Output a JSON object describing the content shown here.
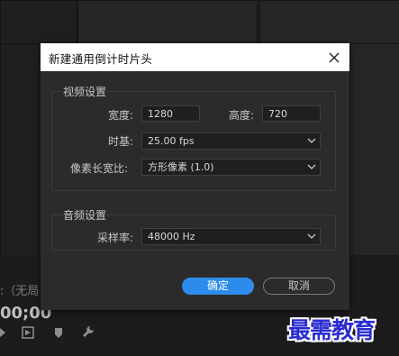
{
  "background": {
    "source_label": ":（无局",
    "timecode": "00;00",
    "icons": [
      "marker-icon",
      "insert-icon",
      "clip-marker-icon",
      "wrench-icon"
    ]
  },
  "dialog": {
    "title": "新建通用倒计时片头",
    "video": {
      "group_title": "视频设置",
      "width_label": "宽度:",
      "width_value": "1280",
      "height_label": "高度:",
      "height_value": "720",
      "timebase_label": "时基:",
      "timebase_value": "25.00 fps",
      "pixel_aspect_label": "像素长宽比:",
      "pixel_aspect_value": "方形像素 (1.0)"
    },
    "audio": {
      "group_title": "音频设置",
      "sample_rate_label": "采样率:",
      "sample_rate_value": "48000 Hz"
    },
    "buttons": {
      "ok": "确定",
      "cancel": "取消"
    }
  },
  "watermark": "最需教育",
  "colors": {
    "accent": "#2d8ceb",
    "dialog_bg": "#2b2b2b",
    "titlebar_bg": "#ffffff",
    "watermark": "#2a2bd0"
  }
}
